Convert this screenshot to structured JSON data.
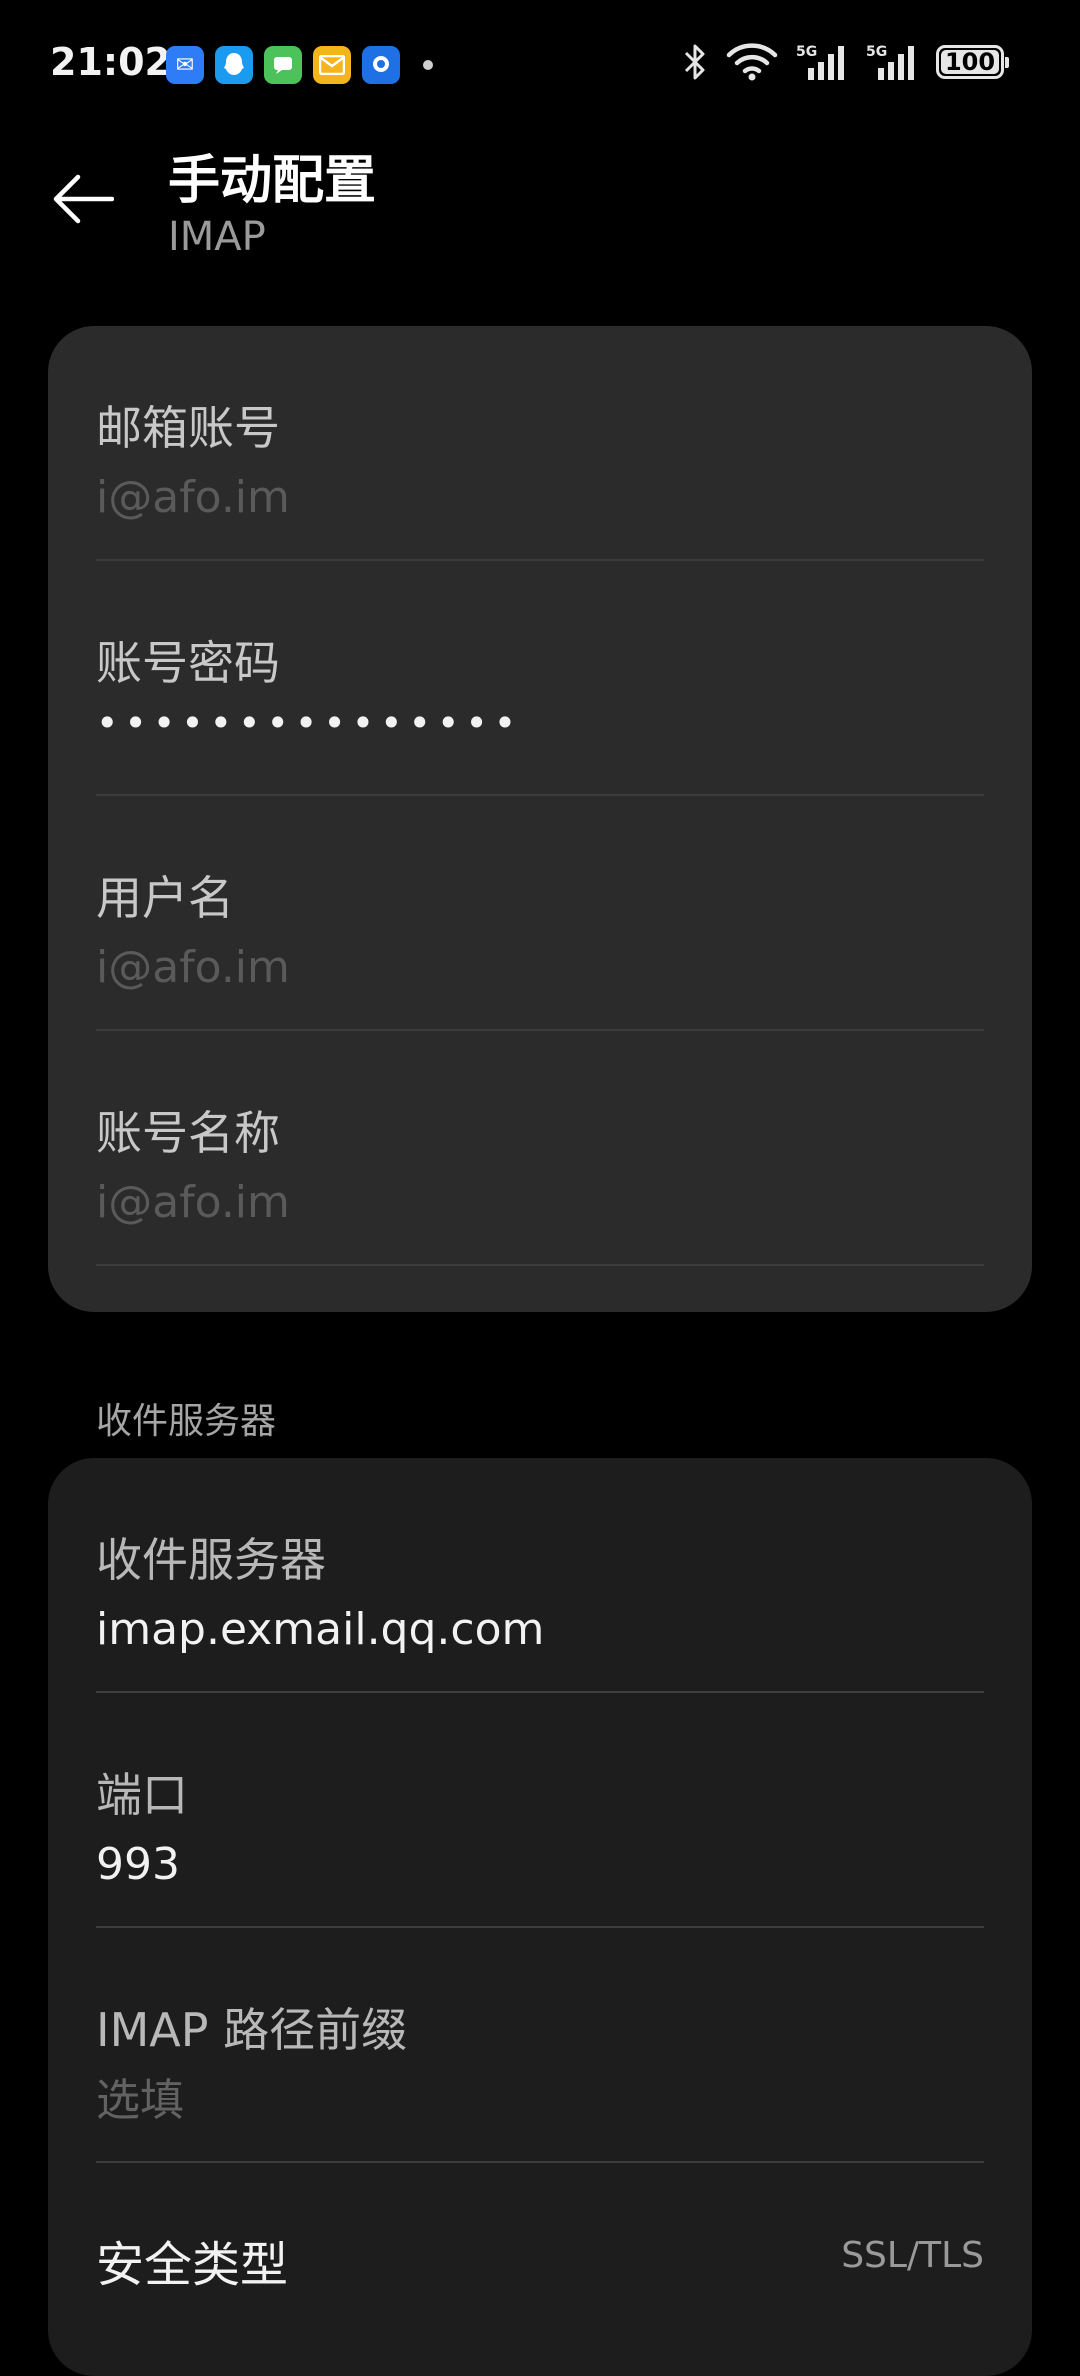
{
  "status_bar": {
    "time": "21:02",
    "notification_icons": [
      "mail-app-icon",
      "qq-icon",
      "message-icon",
      "email-icon",
      "browser-app-icon"
    ],
    "battery": "100"
  },
  "header": {
    "title": "手动配置",
    "subtitle": "IMAP"
  },
  "account": {
    "email_label": "邮箱账号",
    "email_placeholder": "i@afo.im",
    "password_label": "账号密码",
    "password_value": "•••••••••••••••",
    "username_label": "用户名",
    "username_placeholder": "i@afo.im",
    "account_name_label": "账号名称",
    "account_name_placeholder": "i@afo.im"
  },
  "incoming": {
    "section_title": "收件服务器",
    "server_label": "收件服务器",
    "server_value": "imap.exmail.qq.com",
    "port_label": "端口",
    "port_value": "993",
    "prefix_label": "IMAP 路径前缀",
    "prefix_placeholder": "选填",
    "security_label": "安全类型",
    "security_value": "SSL/TLS"
  }
}
